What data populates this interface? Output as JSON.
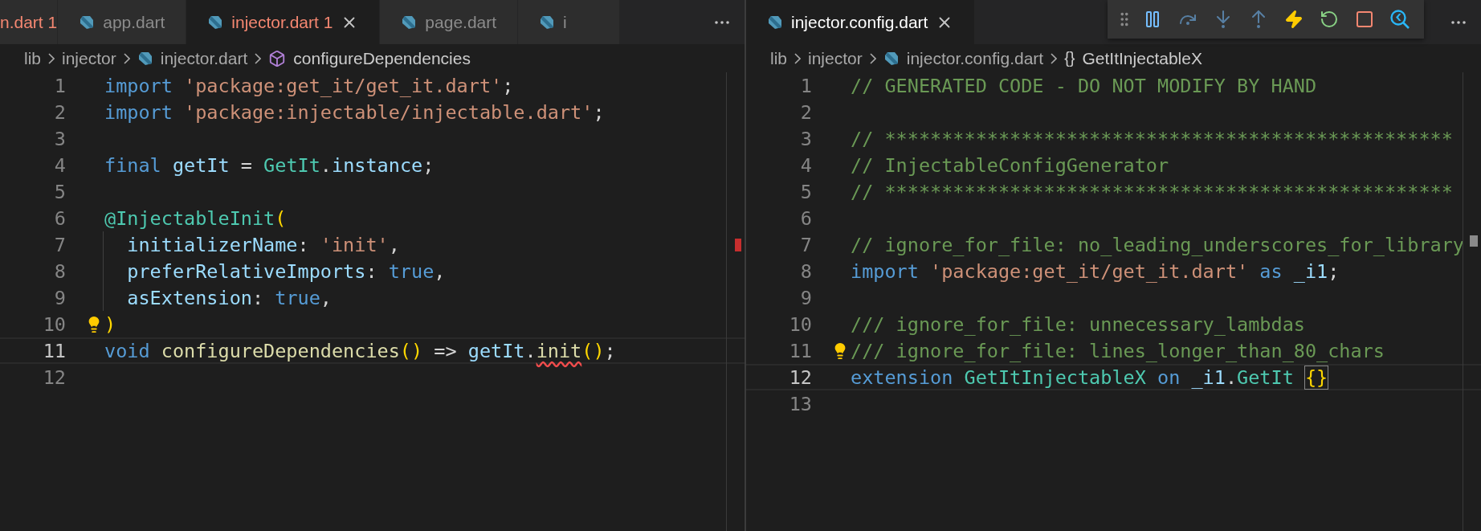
{
  "panes": [
    {
      "tabs": [
        {
          "label": "n.dart",
          "problems": "1",
          "error": true,
          "selected": false,
          "icon": false,
          "close": false
        },
        {
          "label": "app.dart",
          "error": false,
          "selected": false,
          "icon": true,
          "close": false
        },
        {
          "label": "injector.dart",
          "problems": "1",
          "error": true,
          "selected": true,
          "icon": true,
          "close": true
        },
        {
          "label": "page.dart",
          "error": false,
          "selected": false,
          "icon": true,
          "close": false
        },
        {
          "label": "i",
          "error": false,
          "selected": false,
          "icon": true,
          "close": false
        }
      ],
      "debug_toolbar": false,
      "breadcrumbs": [
        {
          "label": "lib",
          "kind": "folder"
        },
        {
          "label": "injector",
          "kind": "folder"
        },
        {
          "label": "injector.dart",
          "kind": "file"
        },
        {
          "label": "configureDependencies",
          "kind": "method"
        }
      ],
      "error_marker": true,
      "lines": [
        {
          "number": "1",
          "current": false,
          "lightbulb": false,
          "indent_guide": false,
          "tokens": [
            {
              "kind": "keyword",
              "text": "import"
            },
            {
              "kind": "string",
              "text": " 'package:get_it/get_it.dart'"
            },
            {
              "kind": "plain",
              "text": ";"
            }
          ]
        },
        {
          "number": "2",
          "current": false,
          "lightbulb": false,
          "indent_guide": false,
          "tokens": [
            {
              "kind": "keyword",
              "text": "import"
            },
            {
              "kind": "string",
              "text": " 'package:injectable/injectable.dart'"
            },
            {
              "kind": "plain",
              "text": ";"
            }
          ]
        },
        {
          "number": "3",
          "current": false,
          "lightbulb": false,
          "indent_guide": false
        },
        {
          "number": "4",
          "current": false,
          "lightbulb": false,
          "indent_guide": false,
          "tokens": [
            {
              "kind": "keyword",
              "text": "final"
            },
            {
              "kind": "variable",
              "text": " getIt"
            },
            {
              "kind": "plain",
              "text": " = "
            },
            {
              "kind": "type",
              "text": "GetIt"
            },
            {
              "kind": "plain",
              "text": "."
            },
            {
              "kind": "variable",
              "text": "instance"
            },
            {
              "kind": "plain",
              "text": ";"
            }
          ]
        },
        {
          "number": "5",
          "current": false,
          "lightbulb": false,
          "indent_guide": false
        },
        {
          "number": "6",
          "current": false,
          "lightbulb": false,
          "indent_guide": false,
          "tokens": [
            {
              "kind": "type",
              "text": "@InjectableInit"
            },
            {
              "kind": "bracket",
              "text": "("
            }
          ]
        },
        {
          "number": "7",
          "current": false,
          "lightbulb": false,
          "indent_guide": true,
          "tokens": [
            {
              "kind": "variable",
              "text": "  initializerName"
            },
            {
              "kind": "plain",
              "text": ": "
            },
            {
              "kind": "string",
              "text": "'init'"
            },
            {
              "kind": "plain",
              "text": ","
            }
          ]
        },
        {
          "number": "8",
          "current": false,
          "lightbulb": false,
          "indent_guide": true,
          "tokens": [
            {
              "kind": "variable",
              "text": "  preferRelativeImports"
            },
            {
              "kind": "plain",
              "text": ": "
            },
            {
              "kind": "keyword",
              "text": "true"
            },
            {
              "kind": "plain",
              "text": ","
            }
          ]
        },
        {
          "number": "9",
          "current": false,
          "lightbulb": false,
          "indent_guide": true,
          "tokens": [
            {
              "kind": "variable",
              "text": "  asExtension"
            },
            {
              "kind": "plain",
              "text": ": "
            },
            {
              "kind": "keyword",
              "text": "true"
            },
            {
              "kind": "plain",
              "text": ","
            }
          ]
        },
        {
          "number": "10",
          "current": false,
          "lightbulb": true,
          "indent_guide": false,
          "tokens": [
            {
              "kind": "bracket",
              "text": ")"
            }
          ]
        },
        {
          "number": "11",
          "current": true,
          "lightbulb": false,
          "indent_guide": false,
          "tokens": [
            {
              "kind": "keyword",
              "text": "void"
            },
            {
              "kind": "function",
              "text": " configureDependencies"
            },
            {
              "kind": "bracket",
              "text": "()"
            },
            {
              "kind": "plain",
              "text": " => "
            },
            {
              "kind": "variable",
              "text": "getIt"
            },
            {
              "kind": "plain",
              "text": "."
            },
            {
              "kind": "function",
              "text": "init",
              "error": true
            },
            {
              "kind": "bracket",
              "text": "()"
            },
            {
              "kind": "plain",
              "text": ";"
            }
          ]
        },
        {
          "number": "12",
          "current": false,
          "lightbulb": false,
          "indent_guide": false
        }
      ]
    },
    {
      "tabs": [
        {
          "label": "injector.config.dart",
          "error": false,
          "selected": true,
          "icon": true,
          "close": true
        }
      ],
      "debug_toolbar": true,
      "breadcrumbs": [
        {
          "label": "lib",
          "kind": "folder"
        },
        {
          "label": "injector",
          "kind": "folder"
        },
        {
          "label": "injector.config.dart",
          "kind": "file"
        },
        {
          "label": "GetItInjectableX",
          "kind": "namespace",
          "symbol": "{}"
        }
      ],
      "error_marker": false,
      "lines": [
        {
          "number": "1",
          "current": false,
          "lightbulb": false,
          "indent_guide": false,
          "tokens": [
            {
              "kind": "comment",
              "text": "// GENERATED CODE - DO NOT MODIFY BY HAND"
            }
          ]
        },
        {
          "number": "2",
          "current": false,
          "lightbulb": false,
          "indent_guide": false
        },
        {
          "number": "3",
          "current": false,
          "lightbulb": false,
          "indent_guide": false,
          "tokens": [
            {
              "kind": "comment",
              "text": "// **************************************************"
            }
          ]
        },
        {
          "number": "4",
          "current": false,
          "lightbulb": false,
          "indent_guide": false,
          "tokens": [
            {
              "kind": "comment",
              "text": "// InjectableConfigGenerator"
            }
          ]
        },
        {
          "number": "5",
          "current": false,
          "lightbulb": false,
          "indent_guide": false,
          "tokens": [
            {
              "kind": "comment",
              "text": "// **************************************************"
            }
          ]
        },
        {
          "number": "6",
          "current": false,
          "lightbulb": false,
          "indent_guide": false
        },
        {
          "number": "7",
          "current": false,
          "lightbulb": false,
          "indent_guide": false,
          "tokens": [
            {
              "kind": "comment",
              "text": "// ignore_for_file: no_leading_underscores_for_library"
            }
          ]
        },
        {
          "number": "8",
          "current": false,
          "lightbulb": false,
          "indent_guide": false,
          "tokens": [
            {
              "kind": "keyword",
              "text": "import"
            },
            {
              "kind": "string",
              "text": " 'package:get_it/get_it.dart'"
            },
            {
              "kind": "keyword",
              "text": " as"
            },
            {
              "kind": "variable",
              "text": " _i1"
            },
            {
              "kind": "plain",
              "text": ";"
            }
          ]
        },
        {
          "number": "9",
          "current": false,
          "lightbulb": false,
          "indent_guide": false
        },
        {
          "number": "10",
          "current": false,
          "lightbulb": false,
          "indent_guide": false,
          "tokens": [
            {
              "kind": "comment",
              "text": "/// ignore_for_file: unnecessary_lambdas"
            }
          ]
        },
        {
          "number": "11",
          "current": false,
          "lightbulb": true,
          "indent_guide": false,
          "tokens": [
            {
              "kind": "comment",
              "text": "/// ignore_for_file: lines_longer_than_80_chars"
            }
          ]
        },
        {
          "number": "12",
          "current": true,
          "lightbulb": false,
          "indent_guide": false,
          "tokens": [
            {
              "kind": "keyword",
              "text": "extension"
            },
            {
              "kind": "type",
              "text": " GetItInjectableX"
            },
            {
              "kind": "keyword",
              "text": " on"
            },
            {
              "kind": "variable",
              "text": " _i1"
            },
            {
              "kind": "plain",
              "text": "."
            },
            {
              "kind": "type",
              "text": "GetIt"
            },
            {
              "kind": "bracket",
              "text": "{}",
              "matched": true
            }
          ]
        },
        {
          "number": "13",
          "current": false,
          "lightbulb": false,
          "indent_guide": false
        }
      ]
    }
  ],
  "debug_buttons": [
    {
      "kind": "pause",
      "disabled": false
    },
    {
      "kind": "step-over",
      "disabled": true
    },
    {
      "kind": "step-into",
      "disabled": true
    },
    {
      "kind": "step-out",
      "disabled": true
    },
    {
      "kind": "hot-reload",
      "disabled": false
    },
    {
      "kind": "restart",
      "disabled": false
    },
    {
      "kind": "stop",
      "disabled": false
    },
    {
      "kind": "inspector",
      "disabled": false
    }
  ]
}
